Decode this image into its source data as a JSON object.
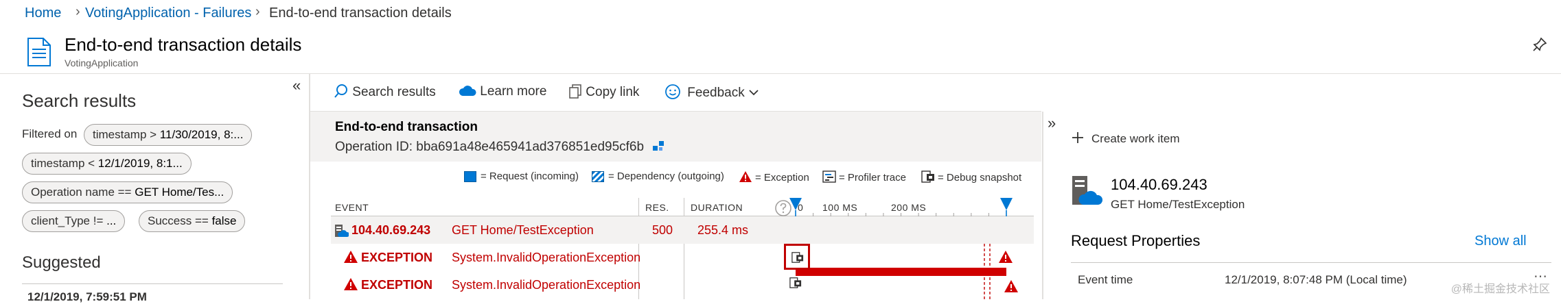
{
  "breadcrumb": {
    "items": [
      "Home",
      "VotingApplication - Failures",
      "End-to-end transaction details"
    ]
  },
  "header": {
    "title": "End-to-end transaction details",
    "subtitle": "VotingApplication"
  },
  "left_panel": {
    "title": "Search results",
    "filtered_on_label": "Filtered on",
    "filters": [
      {
        "prefix": "timestamp > ",
        "value": "11/30/2019, 8:..."
      },
      {
        "prefix": "timestamp < ",
        "value": "12/1/2019, 8:1..."
      },
      {
        "prefix": "Operation name == ",
        "value": "GET Home/Tes..."
      },
      {
        "prefix": "client_Type != ",
        "value": "..."
      },
      {
        "prefix": "Success == ",
        "value": "false"
      }
    ],
    "suggested_title": "Suggested",
    "suggested_item": "12/1/2019, 7:59:51 PM",
    "collapse_icon": "«"
  },
  "toolbar": {
    "search_results": "Search results",
    "learn_more": "Learn more",
    "copy_link": "Copy link",
    "feedback": "Feedback"
  },
  "transaction": {
    "title": "End-to-end transaction",
    "operation_id_label": "Operation ID:",
    "operation_id": "bba691a48e465941ad376851ed95cf6b",
    "legend": {
      "request": "= Request (incoming)",
      "dependency": "= Dependency (outgoing)",
      "exception": "= Exception",
      "profiler": "= Profiler trace",
      "snapshot": "= Debug snapshot"
    },
    "columns": {
      "event": "EVENT",
      "res": "RES.",
      "duration": "DURATION"
    },
    "ticks": [
      "0",
      "100 MS",
      "200 MS"
    ],
    "rows": [
      {
        "event": "104.40.69.243",
        "name": "GET Home/TestException",
        "res": "500",
        "duration": "255.4 ms",
        "duration_fraction": 1.0
      },
      {
        "event": "EXCEPTION",
        "name": "System.InvalidOperationException"
      },
      {
        "event": "EXCEPTION",
        "name": "System.InvalidOperationException"
      }
    ]
  },
  "right_panel": {
    "expand_icon": "»",
    "create_work_item": "Create work item",
    "ip": "104.40.69.243",
    "operation": "GET Home/TestException",
    "properties_title": "Request Properties",
    "show_all": "Show all",
    "event_time_label": "Event time",
    "event_time_value": "12/1/2019, 8:07:48 PM (Local time)"
  },
  "watermark": "@稀土掘金技术社区",
  "colors": {
    "accent": "#0078d4",
    "error": "#c00000",
    "bar": "#d00000"
  }
}
